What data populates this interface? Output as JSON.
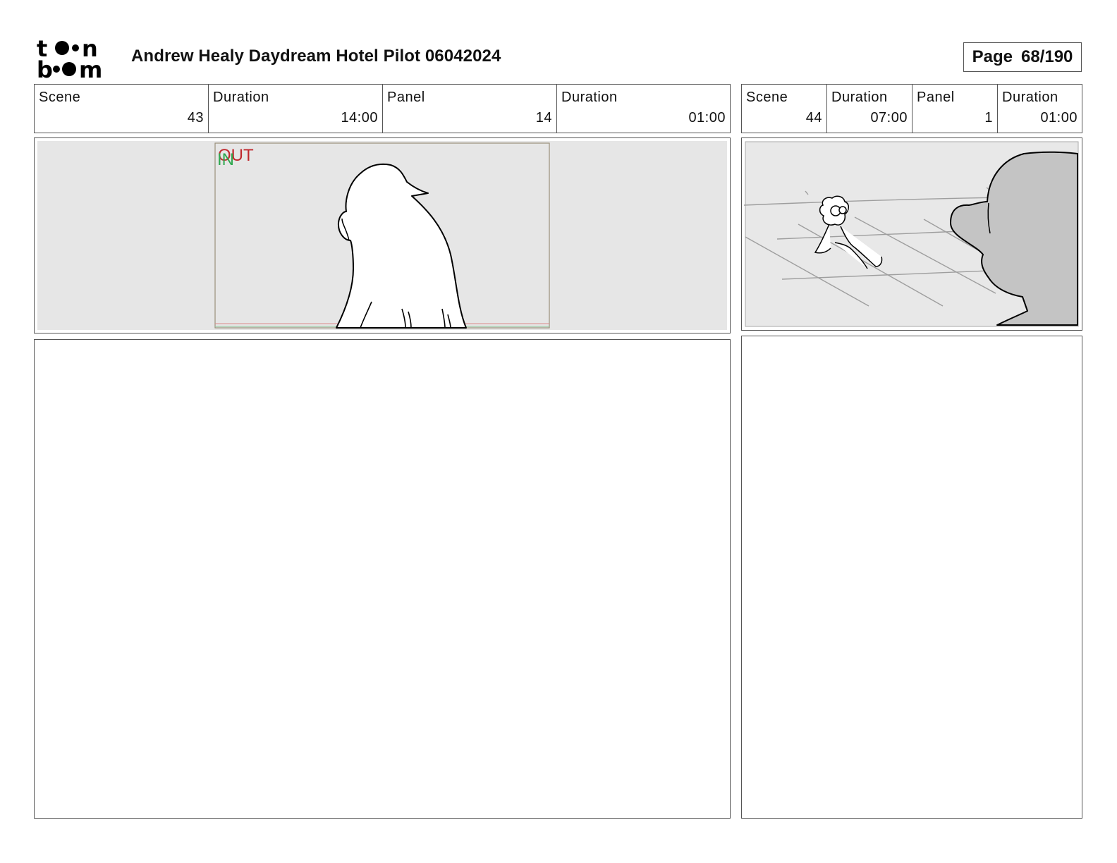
{
  "header": {
    "logo_text": "toon boom",
    "title": "Andrew Healy Daydream Hotel Pilot 06042024",
    "page_label": "Page",
    "page_value": "68/190"
  },
  "left": {
    "info": {
      "scene_label": "Scene",
      "scene_value": "43",
      "scene_duration_label": "Duration",
      "scene_duration_value": "14:00",
      "panel_label": "Panel",
      "panel_value": "14",
      "panel_duration_label": "Duration",
      "panel_duration_value": "01:00"
    },
    "marker_out": "OUT",
    "marker_in": "IN"
  },
  "right": {
    "info": {
      "scene_label": "Scene",
      "scene_value": "44",
      "scene_duration_label": "Duration",
      "scene_duration_value": "07:00",
      "panel_label": "Panel",
      "panel_value": "1",
      "panel_duration_label": "Duration",
      "panel_duration_value": "01:00"
    }
  },
  "colors": {
    "frame_border": "#555555",
    "panel_background": "#e6e6e6",
    "out_marker": "#c0282d",
    "in_marker": "#2fa84f"
  }
}
